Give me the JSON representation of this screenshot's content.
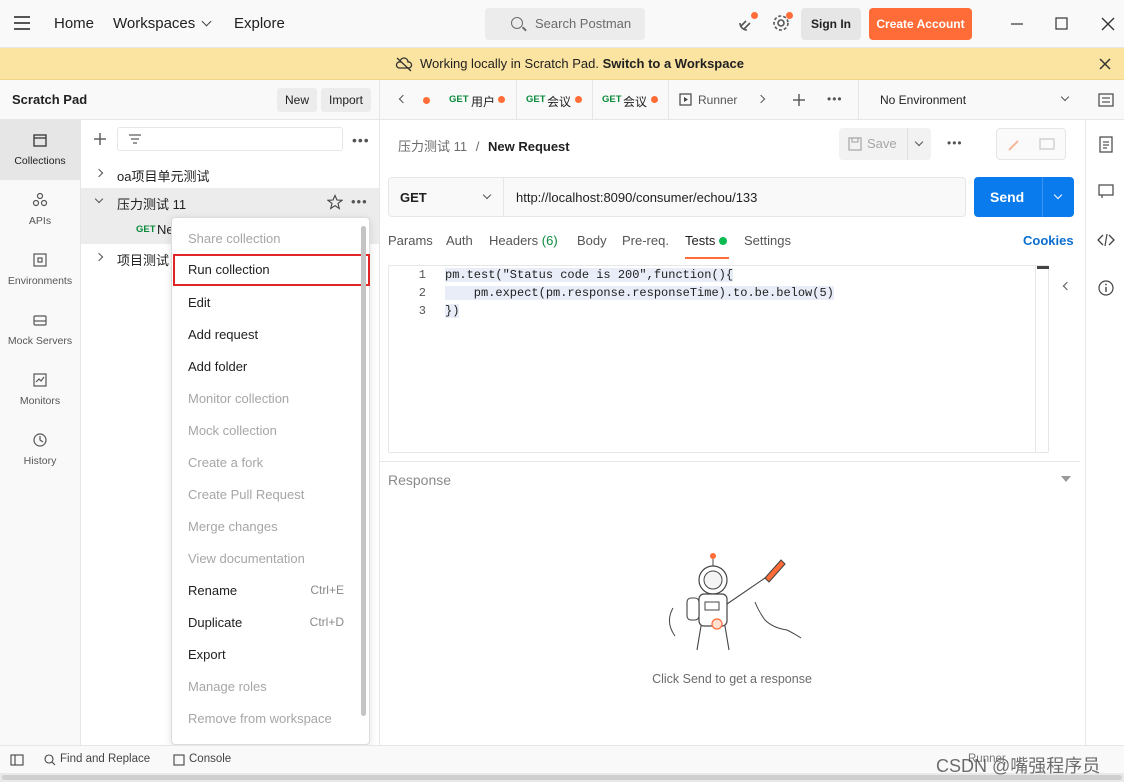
{
  "topbar": {
    "nav": [
      "Home",
      "Workspaces",
      "Explore"
    ],
    "search_placeholder": "Search Postman",
    "sign_in": "Sign In",
    "create_account": "Create Account"
  },
  "banner": {
    "text": "Working locally in Scratch Pad.",
    "link": "Switch to a Workspace"
  },
  "left_header": {
    "title": "Scratch Pad",
    "new_label": "New",
    "import_label": "Import"
  },
  "rail": [
    {
      "label": "Collections",
      "icon": "collections-icon"
    },
    {
      "label": "APIs",
      "icon": "apis-icon"
    },
    {
      "label": "Environments",
      "icon": "environments-icon"
    },
    {
      "label": "Mock Servers",
      "icon": "mock-servers-icon"
    },
    {
      "label": "Monitors",
      "icon": "monitors-icon"
    },
    {
      "label": "History",
      "icon": "history-icon"
    }
  ],
  "tree": {
    "items": [
      "oa项目单元测试",
      "压力测试 11",
      "项目测试"
    ],
    "child": {
      "method": "GET",
      "label": "Ne"
    }
  },
  "context_menu": [
    {
      "label": "Share collection",
      "enabled": false,
      "shortcut": ""
    },
    {
      "label": "Run collection",
      "enabled": true,
      "shortcut": "",
      "highlighted": true
    },
    {
      "label": "Edit",
      "enabled": true,
      "shortcut": ""
    },
    {
      "label": "Add request",
      "enabled": true,
      "shortcut": ""
    },
    {
      "label": "Add folder",
      "enabled": true,
      "shortcut": ""
    },
    {
      "label": "Monitor collection",
      "enabled": false,
      "shortcut": ""
    },
    {
      "label": "Mock collection",
      "enabled": false,
      "shortcut": ""
    },
    {
      "label": "Create a fork",
      "enabled": false,
      "shortcut": ""
    },
    {
      "label": "Create Pull Request",
      "enabled": false,
      "shortcut": ""
    },
    {
      "label": "Merge changes",
      "enabled": false,
      "shortcut": ""
    },
    {
      "label": "View documentation",
      "enabled": false,
      "shortcut": ""
    },
    {
      "label": "Rename",
      "enabled": true,
      "shortcut": "Ctrl+E"
    },
    {
      "label": "Duplicate",
      "enabled": true,
      "shortcut": "Ctrl+D"
    },
    {
      "label": "Export",
      "enabled": true,
      "shortcut": ""
    },
    {
      "label": "Manage roles",
      "enabled": false,
      "shortcut": ""
    },
    {
      "label": "Remove from workspace",
      "enabled": false,
      "shortcut": ""
    }
  ],
  "tabs": [
    {
      "method": "GET",
      "label": "用户"
    },
    {
      "method": "GET",
      "label": "会议"
    },
    {
      "method": "GET",
      "label": "会议"
    },
    {
      "method": "",
      "label": "Runner"
    }
  ],
  "environment": "No Environment",
  "request": {
    "breadcrumb_parent": "压力测试 11",
    "breadcrumb_sep": "/",
    "name": "New Request",
    "save_label": "Save",
    "method": "GET",
    "url": "http://localhost:8090/consumer/echou/133",
    "send_label": "Send",
    "subtabs": [
      "Params",
      "Auth",
      "Headers",
      "Body",
      "Pre-req.",
      "Tests",
      "Settings"
    ],
    "headers_count": "(6)",
    "cookies_label": "Cookies",
    "code_lines": [
      {
        "n": "1",
        "text": "pm.test(\"Status code is 200\",function(){"
      },
      {
        "n": "2",
        "text": "    pm.expect(pm.response.responseTime).to.be.below(5)"
      },
      {
        "n": "3",
        "text": "})"
      }
    ]
  },
  "response": {
    "title": "Response",
    "empty_message": "Click Send to get a response"
  },
  "statusbar": {
    "find_replace": "Find and Replace",
    "console": "Console",
    "right": "Runner"
  },
  "watermark": "CSDN @嘴强程序员",
  "colors": {
    "accent": "#ff6c37",
    "send": "#097bed",
    "banner": "#fbe3a1",
    "get_method": "#0b8a3c"
  }
}
